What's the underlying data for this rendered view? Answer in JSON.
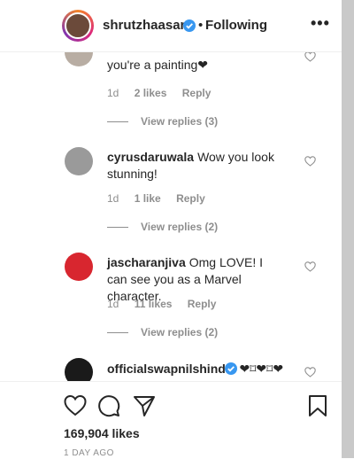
{
  "header": {
    "username": "shrutzhaasan",
    "dot": "•",
    "follow_status": "Following",
    "more": "•••"
  },
  "comments": [
    {
      "user": "",
      "text": "you're a painting❤",
      "age": "1d",
      "likes": "2 likes",
      "reply": "Reply",
      "view_replies": "View replies (3)"
    },
    {
      "user": "cyrusdaruwala",
      "text": "Wow you look stunning!",
      "age": "1d",
      "likes": "1 like",
      "reply": "Reply",
      "view_replies": "View replies (2)"
    },
    {
      "user": "jascharanjiva",
      "text": "Omg LOVE! I can see you as a Marvel character.",
      "age": "1d",
      "likes": "11 likes",
      "reply": "Reply",
      "view_replies": "View replies (2)"
    },
    {
      "user": "officialswapnilshinde",
      "text": "❤⌑❤⌑❤",
      "age": "",
      "likes": "",
      "reply": "",
      "view_replies": ""
    }
  ],
  "footer": {
    "likes": "169,904 likes",
    "time": "1 DAY AGO"
  },
  "icons": {
    "heart": "heart-icon",
    "comment": "comment-icon",
    "share": "share-icon",
    "save": "bookmark-icon",
    "verified": "verified-badge-icon"
  },
  "colors": {
    "verified_blue": "#3897f0",
    "text": "#262626",
    "muted": "#8e8e8e"
  }
}
